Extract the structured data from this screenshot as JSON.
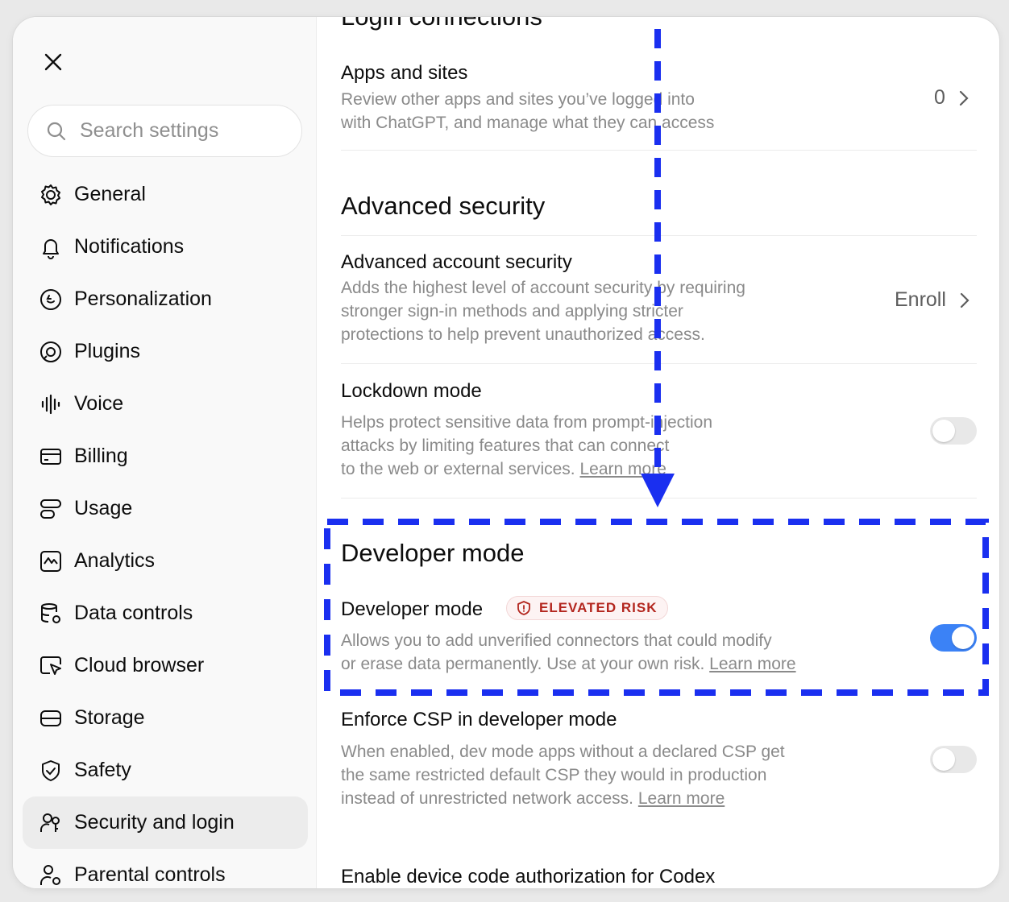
{
  "sidebar": {
    "search_placeholder": "Search settings",
    "items": [
      {
        "label": "General",
        "icon": "gear-icon"
      },
      {
        "label": "Notifications",
        "icon": "bell-icon"
      },
      {
        "label": "Personalization",
        "icon": "personalization-icon"
      },
      {
        "label": "Plugins",
        "icon": "plugins-icon"
      },
      {
        "label": "Voice",
        "icon": "voice-waveform-icon"
      },
      {
        "label": "Billing",
        "icon": "card-icon"
      },
      {
        "label": "Usage",
        "icon": "usage-icon"
      },
      {
        "label": "Analytics",
        "icon": "analytics-chart-icon"
      },
      {
        "label": "Data controls",
        "icon": "database-gear-icon"
      },
      {
        "label": "Cloud browser",
        "icon": "cloud-browser-icon"
      },
      {
        "label": "Storage",
        "icon": "storage-drive-icon"
      },
      {
        "label": "Safety",
        "icon": "shield-check-icon"
      },
      {
        "label": "Security and login",
        "icon": "security-people-icon",
        "active": true
      },
      {
        "label": "Parental controls",
        "icon": "parental-icon"
      }
    ]
  },
  "main": {
    "login_connections_title": "Login connections",
    "apps_sites": {
      "title": "Apps and sites",
      "desc_line1": "Review other apps and sites you’ve logged into",
      "desc_line2": "with ChatGPT, and manage what they can access",
      "count": "0"
    },
    "advanced_security_title": "Advanced security",
    "advanced_account": {
      "title": "Advanced account security",
      "desc_line1": "Adds the highest level of account security by requiring",
      "desc_line2": "stronger sign-in methods and applying stricter",
      "desc_line3": "protections to help prevent unauthorized access.",
      "action": "Enroll"
    },
    "lockdown": {
      "title": "Lockdown mode",
      "desc_line1": "Helps protect sensitive data from prompt-injection",
      "desc_line2": "attacks by limiting features that can connect",
      "desc_line3": "to the web or external services.",
      "learn_more": "Learn more",
      "enabled": false
    },
    "developer_section_title": "Developer mode",
    "developer": {
      "title": "Developer mode",
      "badge": "ELEVATED RISK",
      "desc_line1": "Allows you to add unverified connectors that could modify",
      "desc_line2": "or erase data permanently. Use at your own risk.",
      "learn_more": "Learn more",
      "enabled": true
    },
    "csp": {
      "title": "Enforce CSP in developer mode",
      "desc_line1": "When enabled, dev mode apps without a declared CSP get",
      "desc_line2": "the same restricted default CSP they would in production",
      "desc_line3": "instead of unrestricted network access.",
      "learn_more": "Learn more",
      "enabled": false
    },
    "codex": {
      "title": "Enable device code authorization for Codex"
    }
  },
  "colors": {
    "accent_toggle": "#3b82f6",
    "annotation_blue": "#1a2ff0",
    "risk_red": "#b3261e"
  }
}
